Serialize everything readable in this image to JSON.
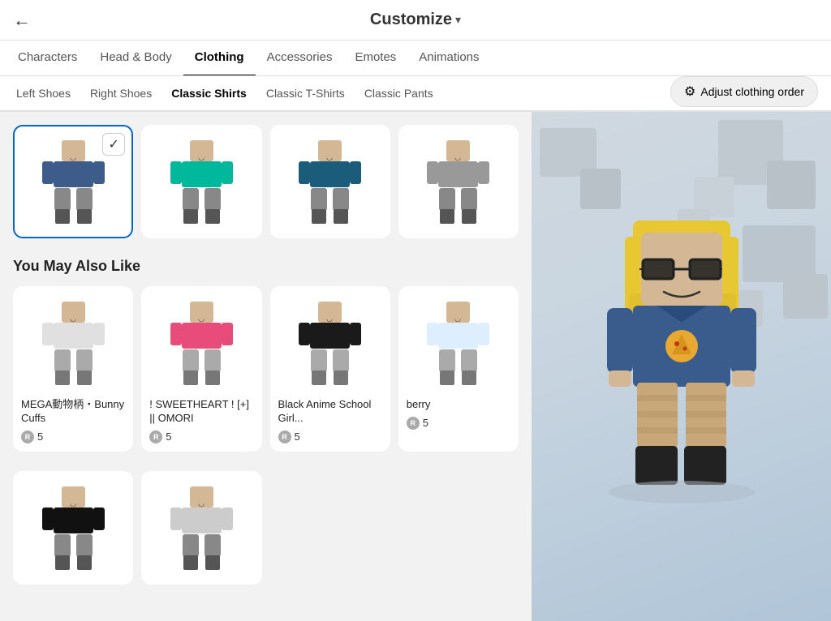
{
  "header": {
    "back_label": "←",
    "title": "Customize",
    "title_arrow": "▾"
  },
  "nav_tabs": [
    {
      "id": "characters",
      "label": "Characters",
      "active": false
    },
    {
      "id": "head-body",
      "label": "Head & Body",
      "active": false
    },
    {
      "id": "clothing",
      "label": "Clothing",
      "active": true
    },
    {
      "id": "accessories",
      "label": "Accessories",
      "active": false
    },
    {
      "id": "emotes",
      "label": "Emotes",
      "active": false
    },
    {
      "id": "animations",
      "label": "Animations",
      "active": false
    }
  ],
  "adjust_btn_label": "Adjust clothing order",
  "sub_tabs": [
    {
      "id": "left-shoes",
      "label": "Left Shoes",
      "active": false
    },
    {
      "id": "right-shoes",
      "label": "Right Shoes",
      "active": false
    },
    {
      "id": "classic-shirts",
      "label": "Classic Shirts",
      "active": true
    },
    {
      "id": "classic-tshirts",
      "label": "Classic T-Shirts",
      "active": false
    },
    {
      "id": "classic-pants",
      "label": "Classic Pants",
      "active": false
    }
  ],
  "selected_item": {
    "color": "#3d5c8a",
    "has_check": true
  },
  "grid_items": [
    {
      "id": 1,
      "selected": true,
      "torso_color": "#3d5c8a",
      "detail": "pizza"
    },
    {
      "id": 2,
      "selected": false,
      "torso_color": "#00b89c",
      "detail": "purple-stripe"
    },
    {
      "id": 3,
      "selected": false,
      "torso_color": "#1a5c7a",
      "detail": "dark-blue"
    },
    {
      "id": 4,
      "selected": false,
      "torso_color": "#999",
      "detail": "gray"
    }
  ],
  "you_may_also_like": "You May Also Like",
  "products": [
    {
      "id": 1,
      "name": "MEGA動物柄・Bunny Cuffs",
      "price": "5",
      "torso_color": "#e0e0e0",
      "detail": "white-bow"
    },
    {
      "id": 2,
      "name": "! SWEETHEART ! [+] || OMORI",
      "price": "5",
      "torso_color": "#e84c7a",
      "detail": "pink-red"
    },
    {
      "id": 3,
      "name": "Black Anime School Girl...",
      "price": "5",
      "torso_color": "#1a1a1a",
      "detail": "black-tie"
    },
    {
      "id": 4,
      "name": "berry",
      "price": "5",
      "torso_color": "#ddeeff",
      "detail": "light-blue"
    }
  ],
  "bottom_items": [
    {
      "id": 5,
      "torso_color": "#111",
      "detail": "black-suit"
    },
    {
      "id": 6,
      "torso_color": "#ccc",
      "detail": "white-maid"
    }
  ]
}
